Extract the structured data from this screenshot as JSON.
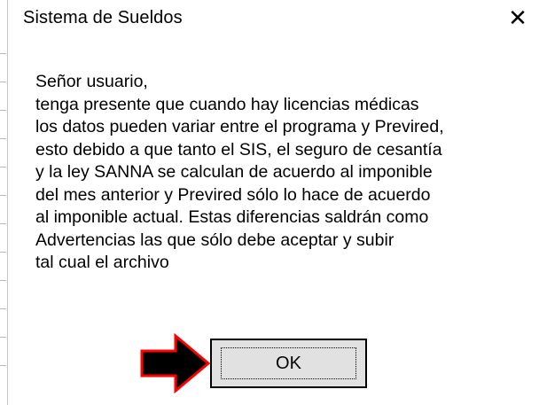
{
  "dialog": {
    "title": "Sistema de Sueldos",
    "close_label": "✕",
    "message_lines": [
      "Señor usuario,",
      "tenga presente que cuando hay licencias médicas",
      "los datos pueden variar entre el programa y Previred,",
      "esto debido a que tanto el SIS, el seguro de cesantía",
      "y la ley SANNA se calculan de acuerdo al imponible",
      "del mes anterior y Previred sólo lo hace de acuerdo",
      "al imponible actual. Estas diferencias saldrán como",
      "Advertencias las que sólo debe aceptar y subir",
      "tal cual el archivo"
    ],
    "ok_label": "OK"
  },
  "annotation": {
    "icon": "arrow-right-icon",
    "fill": "#000000",
    "stroke": "#ff0000"
  }
}
